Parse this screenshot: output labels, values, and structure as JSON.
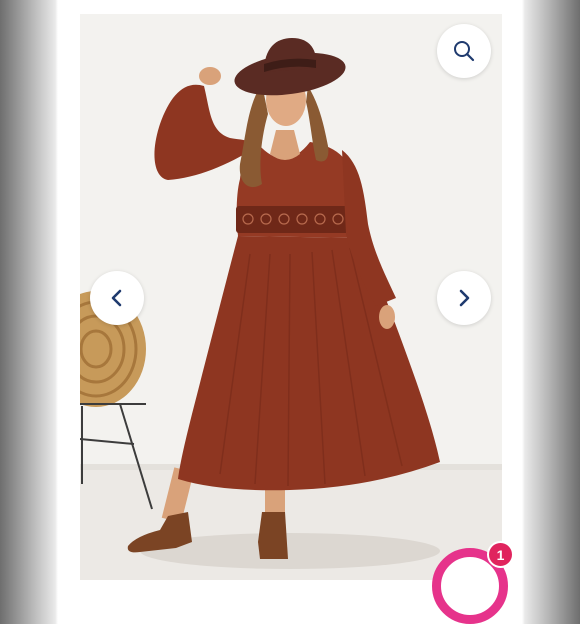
{
  "viewer": {
    "icons": {
      "zoom": "search-icon",
      "prev": "chevron-left-icon",
      "next": "chevron-right-icon",
      "cart": "cart-icon"
    },
    "image": {
      "subject": "product-photo-dress",
      "colors": {
        "dress": "#8e3621",
        "hat": "#5a2b23",
        "boots": "#7b4424",
        "background": "#f3f2ef"
      }
    },
    "cart_badge": "1",
    "accent_color": "#e6338b",
    "button_icon_color": "#1f3a6e"
  }
}
